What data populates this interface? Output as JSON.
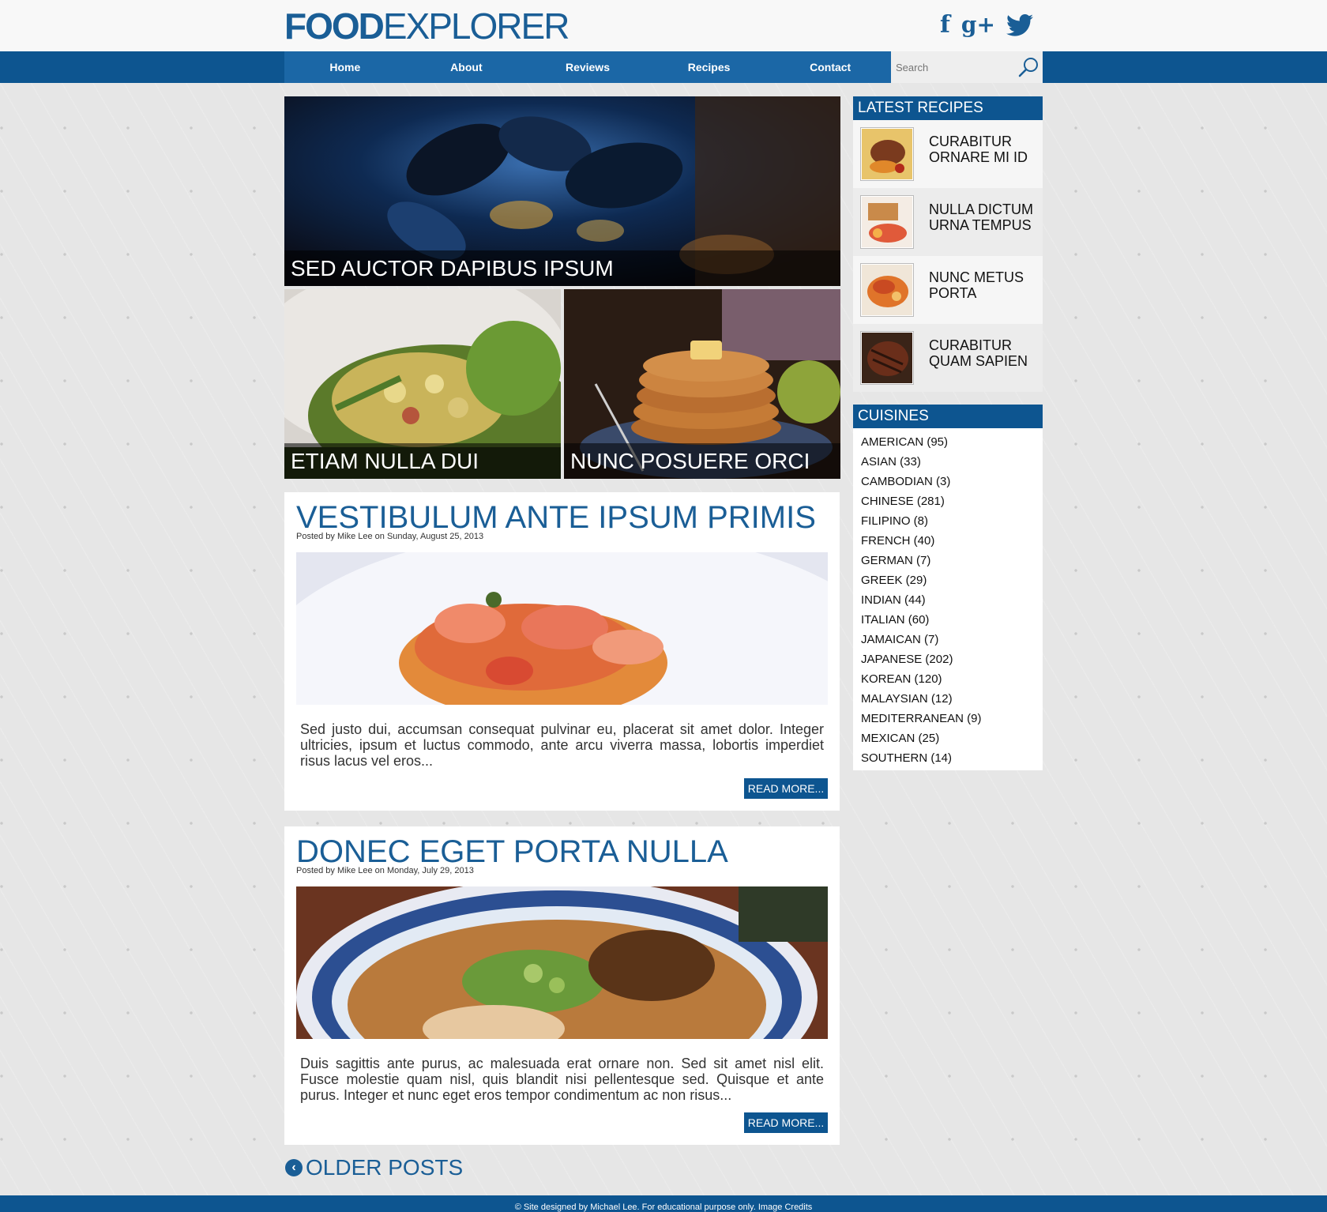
{
  "header": {
    "logo_bold": "FOOD",
    "logo_light": "EXPLORER",
    "social": {
      "facebook": "f",
      "googleplus": "g+",
      "twitter_icon": "twitter-icon"
    }
  },
  "nav": {
    "items": [
      {
        "label": "Home"
      },
      {
        "label": "About"
      },
      {
        "label": "Reviews"
      },
      {
        "label": "Recipes"
      },
      {
        "label": "Contact"
      }
    ],
    "search_placeholder": "Search"
  },
  "featured": {
    "main": {
      "caption": "SED AUCTOR DAPIBUS IPSUM"
    },
    "left": {
      "caption": "ETIAM NULLA DUI"
    },
    "right": {
      "caption": "NUNC POSUERE ORCI"
    }
  },
  "posts": [
    {
      "title": "VESTIBULUM ANTE IPSUM PRIMIS",
      "meta": "Posted by Mike Lee on Sunday, August 25, 2013",
      "excerpt": "Sed justo dui, accumsan consequat pulvinar eu, placerat sit amet dolor. Integer ultricies, ipsum et luctus commodo, ante arcu viverra massa, lobortis imperdiet risus lacus vel eros...",
      "read_more": "READ MORE..."
    },
    {
      "title": "DONEC EGET PORTA NULLA",
      "meta": "Posted by Mike Lee on Monday, July 29, 2013",
      "excerpt": "Duis sagittis ante purus, ac malesuada erat ornare non. Sed sit amet nisl elit. Fusce molestie quam nisl, quis blandit nisi pellentesque sed. Quisque et ante purus. Integer et nunc eget eros tempor condimentum ac non risus...",
      "read_more": "READ MORE..."
    }
  ],
  "older_posts": "OLDER POSTS",
  "sidebar": {
    "latest_title": "LATEST RECIPES",
    "recipes": [
      {
        "title": "CURABITUR ORNARE MI ID"
      },
      {
        "title": "NULLA DICTUM URNA TEMPUS"
      },
      {
        "title": "NUNC METUS PORTA"
      },
      {
        "title": "CURABITUR QUAM SAPIEN"
      }
    ],
    "cuisines_title": "CUISINES",
    "cuisines": [
      {
        "label": "AMERICAN (95)"
      },
      {
        "label": "ASIAN (33)"
      },
      {
        "label": "CAMBODIAN (3)"
      },
      {
        "label": "CHINESE (281)"
      },
      {
        "label": "FILIPINO (8)"
      },
      {
        "label": "FRENCH (40)"
      },
      {
        "label": "GERMAN (7)"
      },
      {
        "label": "GREEK (29)"
      },
      {
        "label": "INDIAN (44)"
      },
      {
        "label": "ITALIAN (60)"
      },
      {
        "label": "JAMAICAN (7)"
      },
      {
        "label": "JAPANESE (202)"
      },
      {
        "label": "KOREAN (120)"
      },
      {
        "label": "MALAYSIAN (12)"
      },
      {
        "label": "MEDITERRANEAN (9)"
      },
      {
        "label": "MEXICAN (25)"
      },
      {
        "label": "SOUTHERN (14)"
      }
    ]
  },
  "footer": {
    "text": "© Site designed by Michael Lee. For educational purpose only. Image Credits"
  },
  "colors": {
    "brand_blue": "#1a5e96",
    "nav_dark": "#0d5590",
    "nav_light": "#1b67a6"
  }
}
